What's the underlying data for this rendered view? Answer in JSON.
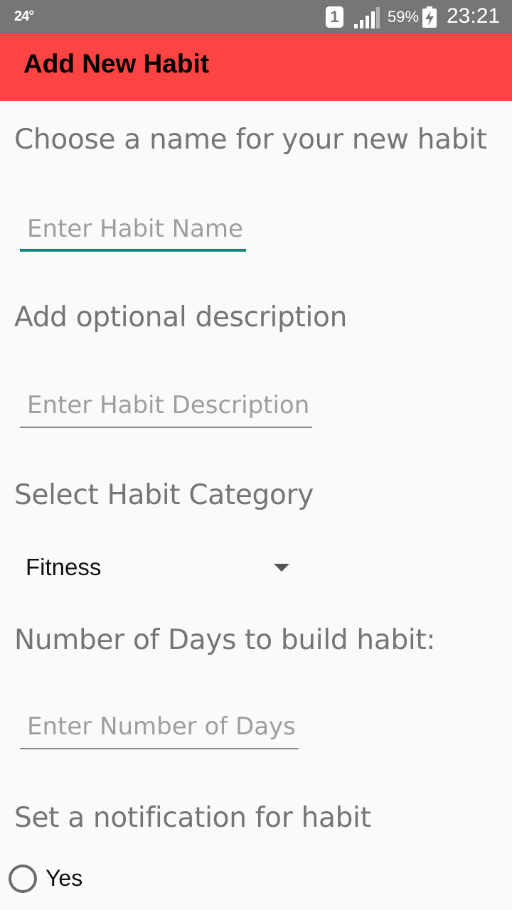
{
  "status_bar": {
    "temperature": "24°",
    "sim_slot": "1",
    "battery_percent": "59%",
    "time": "23:21",
    "icons": [
      "sim-1-icon",
      "signal-icon",
      "battery-charging-icon"
    ]
  },
  "app_bar": {
    "title": "Add New Habit",
    "color": "#fd4444"
  },
  "form": {
    "name_label": "Choose a name for your new habit",
    "name_placeholder": "Enter Habit Name",
    "description_label": "Add optional description",
    "description_placeholder": "Enter Habit Description",
    "category_label": "Select Habit Category",
    "category_selected": "Fitness",
    "days_label": "Number of Days to build habit:",
    "days_placeholder": "Enter Number of Days",
    "notification_label": "Set a notification for habit",
    "notification_options": [
      {
        "label": "Yes",
        "checked": false
      }
    ],
    "accent_color": "#00897b"
  }
}
